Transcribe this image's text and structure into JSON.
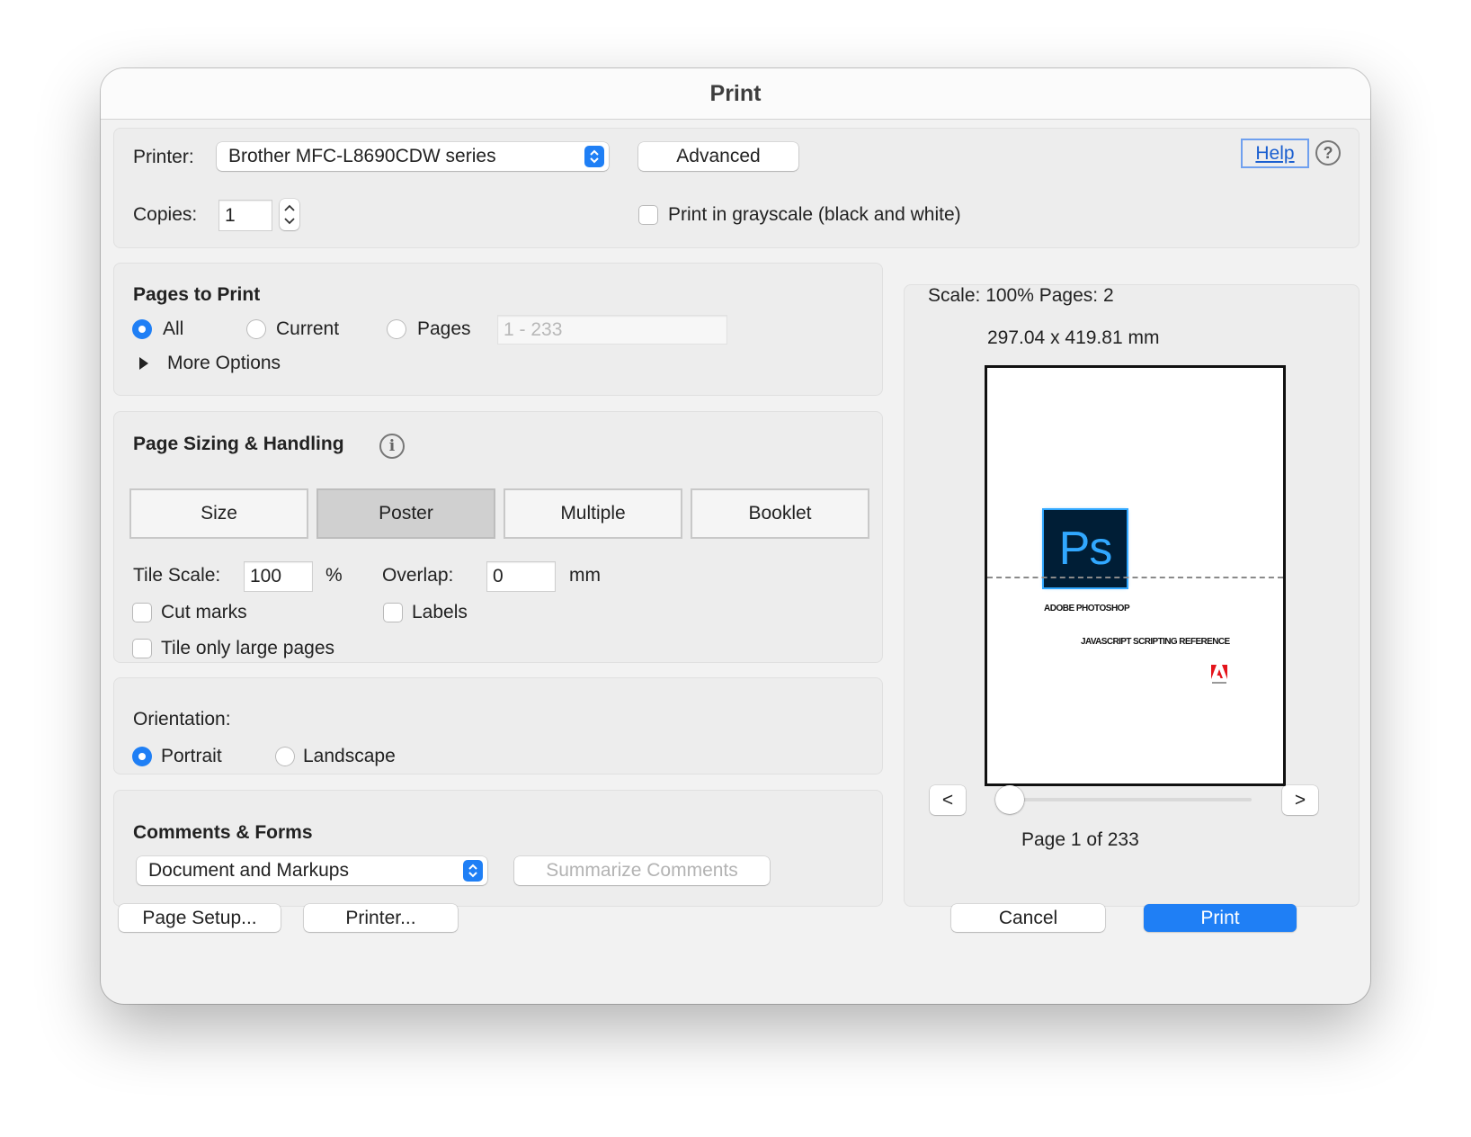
{
  "window": {
    "title": "Print"
  },
  "printer": {
    "label": "Printer:",
    "selected": "Brother MFC-L8690CDW series",
    "advanced_label": "Advanced",
    "help_label": "Help",
    "copies_label": "Copies:",
    "copies_value": "1",
    "grayscale_label": "Print in grayscale (black and white)",
    "grayscale_checked": false
  },
  "pages_to_print": {
    "heading": "Pages to Print",
    "options": {
      "all": "All",
      "current": "Current",
      "pages": "Pages"
    },
    "selected": "All",
    "pages_placeholder": "1 - 233",
    "more_options": "More Options"
  },
  "sizing": {
    "heading": "Page Sizing & Handling",
    "tabs": [
      "Size",
      "Poster",
      "Multiple",
      "Booklet"
    ],
    "active_tab": "Poster",
    "tile_scale_label": "Tile Scale:",
    "tile_scale_value": "100",
    "tile_scale_unit": "%",
    "overlap_label": "Overlap:",
    "overlap_value": "0",
    "overlap_unit": "mm",
    "cut_marks_label": "Cut marks",
    "labels_label": "Labels",
    "tile_large_label": "Tile only large pages"
  },
  "orientation": {
    "label": "Orientation:",
    "portrait": "Portrait",
    "landscape": "Landscape",
    "selected": "Portrait"
  },
  "comments_forms": {
    "heading": "Comments & Forms",
    "selected": "Document and Markups",
    "summarize_label": "Summarize Comments"
  },
  "preview": {
    "scale_text": "Scale: 100% Pages: 2",
    "dimensions": "297.04 x 419.81 mm",
    "doc_logo_text": "Ps",
    "doc_brand": "ADOBE PHOTOSHOP",
    "doc_subtitle": "JAVASCRIPT SCRIPTING REFERENCE",
    "prev_label": "<",
    "next_label": ">",
    "page_status": "Page 1 of 233",
    "current_page": 1,
    "total_pages": 233
  },
  "footer": {
    "page_setup": "Page Setup...",
    "printer": "Printer...",
    "cancel": "Cancel",
    "print": "Print"
  },
  "colors": {
    "accent": "#1f7ff5",
    "ps_logo_bg": "#001e36",
    "ps_logo_fg": "#31a8ff"
  }
}
